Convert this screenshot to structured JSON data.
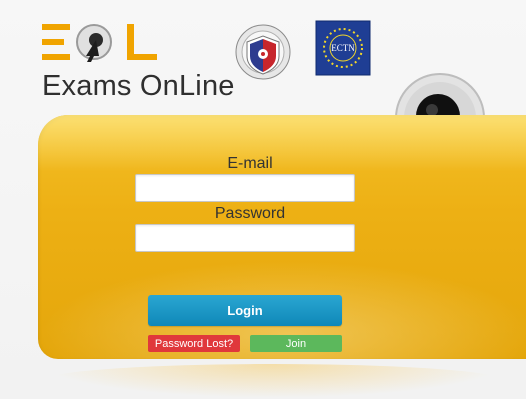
{
  "header": {
    "logo_text": "Exams OnLine",
    "logo_mark_icon": "eol-logo-mark",
    "seal_left_icon": "university-seal-icon",
    "seal_right_icon": "ectn-seal-icon",
    "seal_right_text": "ECTN",
    "big_cursor_icon": "mouse-cursor-icon"
  },
  "form": {
    "email_label": "E-mail",
    "email_value": "",
    "password_label": "Password",
    "password_value": "",
    "login_label": "Login",
    "password_lost_label": "Password Lost?",
    "join_label": "Join"
  },
  "colors": {
    "panel_yellow": "#edb014",
    "login_blue": "#1a96c6",
    "lost_red": "#e0383b",
    "join_green": "#5cb85c",
    "logo_orange": "#f0a400"
  }
}
